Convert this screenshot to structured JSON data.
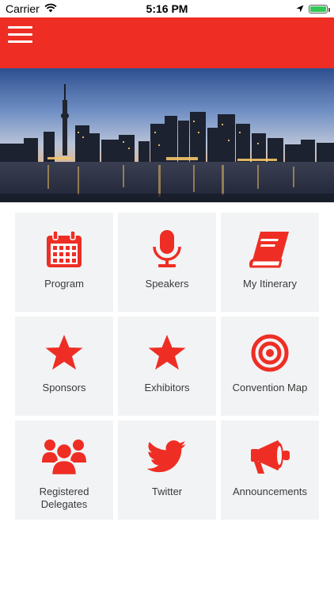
{
  "status_bar": {
    "carrier": "Carrier",
    "time": "5:16 PM",
    "battery_level": 1.0,
    "battery_color": "#35c759"
  },
  "header": {
    "background_color": "#ee2e24",
    "menu_icon": "hamburger-icon"
  },
  "hero": {
    "description_icon": "city-skyline-image"
  },
  "accent_color": "#ee2e24",
  "tiles": [
    {
      "label": "Program",
      "icon": "calendar-icon"
    },
    {
      "label": "Speakers",
      "icon": "microphone-icon"
    },
    {
      "label": "My Itinerary",
      "icon": "book-icon"
    },
    {
      "label": "Sponsors",
      "icon": "star-icon"
    },
    {
      "label": "Exhibitors",
      "icon": "star-icon"
    },
    {
      "label": "Convention Map",
      "icon": "target-icon"
    },
    {
      "label": "Registered\nDelegates",
      "icon": "people-group-icon"
    },
    {
      "label": "Twitter",
      "icon": "twitter-bird-icon"
    },
    {
      "label": "Announcements",
      "icon": "megaphone-icon"
    }
  ]
}
